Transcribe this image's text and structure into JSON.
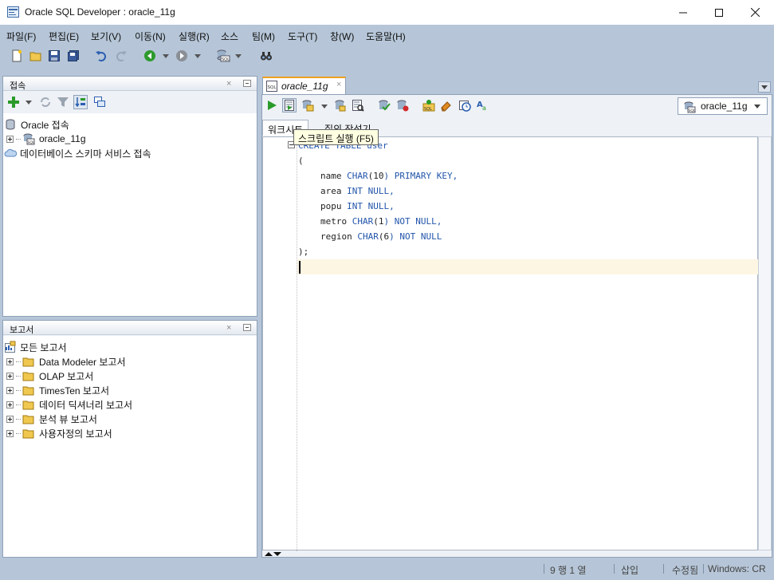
{
  "window": {
    "title": "Oracle SQL Developer : oracle_11g"
  },
  "menu": [
    "파일(F)",
    "편집(E)",
    "보기(V)",
    "이동(N)",
    "실행(R)",
    "소스",
    "팀(M)",
    "도구(T)",
    "창(W)",
    "도움말(H)"
  ],
  "connections_panel": {
    "title": "접속",
    "items": [
      {
        "label": "Oracle 접속",
        "icon": "database-icon"
      },
      {
        "label": "oracle_11g",
        "icon": "sql-connection-icon"
      },
      {
        "label": "데이터베이스 스키마 서비스 접속",
        "icon": "cloud-icon"
      }
    ]
  },
  "reports_panel": {
    "title": "보고서",
    "root": "모든 보고서",
    "items": [
      "Data Modeler 보고서",
      "OLAP 보고서",
      "TimesTen 보고서",
      "데이터 딕셔너리 보고서",
      "분석 뷰 보고서",
      "사용자정의 보고서"
    ]
  },
  "editor": {
    "tab_label": "oracle_11g",
    "connection_selector": "oracle_11g",
    "subtabs": [
      "워크시트",
      "질의 작성기"
    ],
    "tooltip": "스크립트 실행 (F5)",
    "code": {
      "line1": "CREATE TABLE user",
      "line2": "(",
      "line3_name": "name",
      "line3_type": "CHAR",
      "line3_open": "(",
      "line3_num": "10",
      "line3_rest": ") PRIMARY KEY,",
      "line4_name": "area",
      "line4_rest": "INT NULL,",
      "line5_name": "popu",
      "line5_rest": "INT NULL,",
      "line6_name": "metro",
      "line6_type": "CHAR",
      "line6_num": "1",
      "line6_rest": ") NOT NULL,",
      "line7_name": "region",
      "line7_type": "CHAR",
      "line7_num": "6",
      "line7_rest": ") NOT NULL",
      "line8": ");"
    }
  },
  "status": {
    "position": "9 행 1 열",
    "mode": "삽입",
    "modified": "수정됨",
    "line_ending": "Windows: CR"
  },
  "colors": {
    "chrome": "#b6c6d8",
    "keyword": "#2255aa",
    "tab_accent": "#f0a020",
    "current_line": "#fdf6e3"
  }
}
